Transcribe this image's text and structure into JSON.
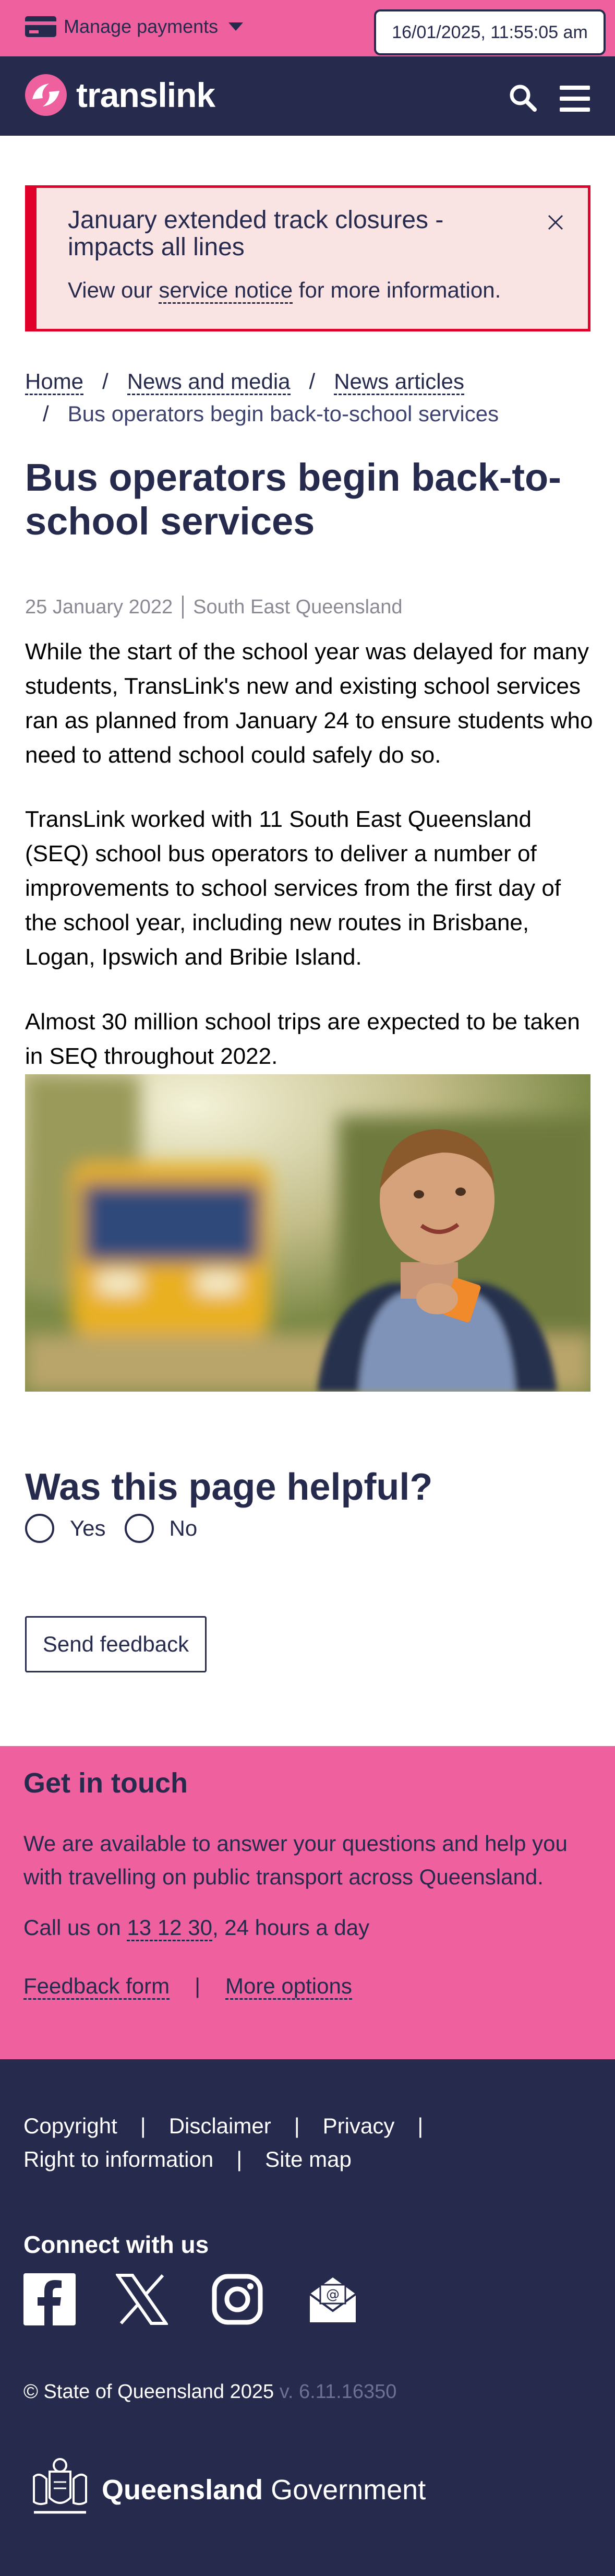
{
  "topbar": {
    "manage_payments": "Manage payments",
    "datetime": "16/01/2025, 11:55:05 am"
  },
  "header": {
    "logo_text": "translink"
  },
  "alert": {
    "title": "January extended track closures - impacts all lines",
    "text_prefix": "View our ",
    "link": "service notice",
    "text_suffix": " for more information."
  },
  "breadcrumb": {
    "items": [
      "Home",
      "News and media",
      "News articles"
    ],
    "separator": "/",
    "current": "Bus operators begin back-to-school services"
  },
  "article": {
    "title": "Bus operators begin back-to-school services",
    "date": "25 January 2022",
    "region": "South East Queensland",
    "paragraphs": [
      "While the start of the school year was delayed for many students, TransLink's new and existing school services ran as planned from January 24 to ensure students who need to attend school could safely do so.",
      "TransLink worked with 11 South East Queensland (SEQ) school bus operators to deliver a number of improvements to school services from the first day of the school year, including new routes in Brisbane, Logan, Ipswich and Bribie Island.",
      "Almost 30 million school trips are expected to be taken in SEQ throughout 2022."
    ]
  },
  "feedback": {
    "question": "Was this page helpful?",
    "yes": "Yes",
    "no": "No",
    "send": "Send feedback"
  },
  "touch": {
    "title": "Get in touch",
    "text": "We are available to answer your questions and help you with travelling on public transport across Queensland.",
    "call_prefix": "Call us on ",
    "phone": "13 12 30",
    "call_suffix": ", 24 hours a day",
    "feedback_form": "Feedback form",
    "separator": "|",
    "more_options": "More options"
  },
  "footer": {
    "links": [
      "Copyright",
      "Disclaimer",
      "Privacy",
      "Right to information",
      "Site map"
    ],
    "separator": "|",
    "connect": "Connect with us",
    "social": [
      "facebook-icon",
      "x-icon",
      "instagram-icon",
      "email-icon"
    ],
    "copyright": "© State of Queensland 2025",
    "version": "v. 6.11.16350",
    "qgov_bold": "Queensland",
    "qgov_regular": " Government"
  },
  "colors": {
    "pink": "#ef609f",
    "navy": "#262a4d",
    "alert_red": "#e0002a",
    "alert_bg": "#fae3e3"
  }
}
